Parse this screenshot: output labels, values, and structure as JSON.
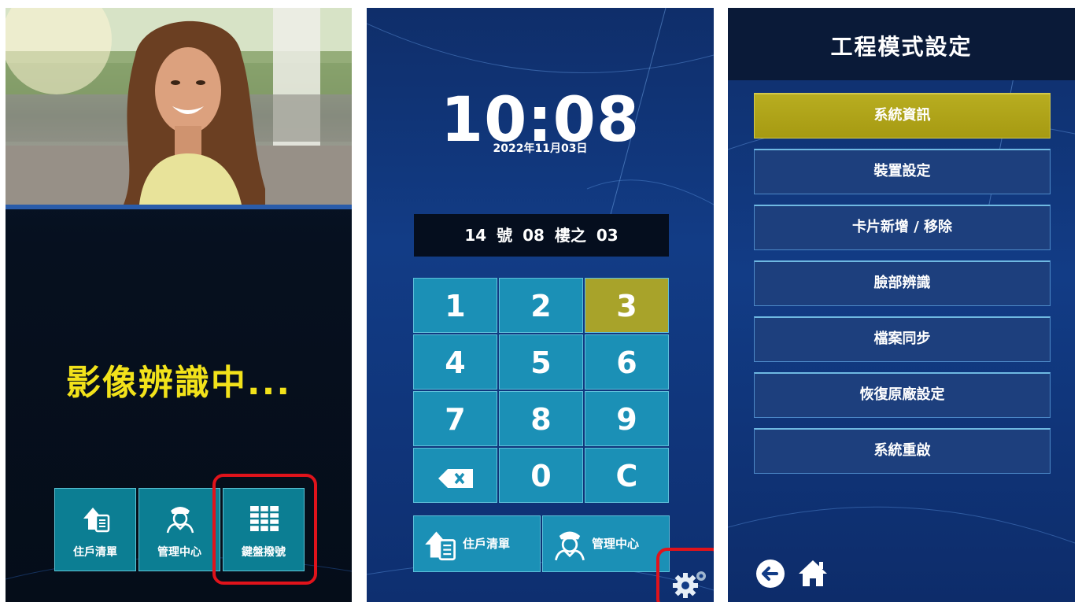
{
  "screen1": {
    "status_text": "影像辨識中...",
    "buttons": [
      {
        "label": "住戶清單",
        "icon": "resident-list-icon"
      },
      {
        "label": "管理中心",
        "icon": "guard-icon"
      },
      {
        "label": "鍵盤撥號",
        "icon": "keypad-grid-icon"
      }
    ]
  },
  "screen2": {
    "time": "10:08",
    "date": "2022年11月03日",
    "dial_display": "14 號 08 樓之 03",
    "keys": [
      "1",
      "2",
      "3",
      "4",
      "5",
      "6",
      "7",
      "8",
      "9",
      "backspace",
      "0",
      "C"
    ],
    "active_key": "3",
    "bottom_buttons": [
      {
        "label": "住戶清單",
        "icon": "resident-list-icon"
      },
      {
        "label": "管理中心",
        "icon": "guard-icon"
      }
    ],
    "settings_icon": "gear-icon"
  },
  "screen3": {
    "title": "工程模式設定",
    "menu": [
      "系統資訊",
      "裝置設定",
      "卡片新增 / 移除",
      "臉部辨識",
      "檔案同步",
      "恢復原廠設定",
      "系統重啟"
    ],
    "selected": "系統資訊",
    "nav": [
      "back-arrow-icon",
      "home-icon"
    ]
  },
  "colors": {
    "highlight_border": "#e0131b",
    "status_yellow": "#f2e21a",
    "key_teal": "#1b90b6",
    "key_active": "#a8a32a",
    "menu_selected": "#b8ad20"
  }
}
